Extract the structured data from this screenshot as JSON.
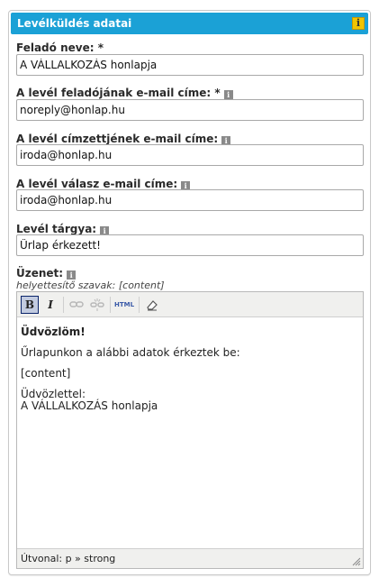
{
  "panel": {
    "title": "Levélküldés adatai",
    "info_glyph": "i"
  },
  "fields": [
    {
      "label": "Feladó neve: *",
      "value": "A VÁLLALKOZÁS honlapja",
      "has_info": false
    },
    {
      "label": "A levél feladójának e-mail címe: *",
      "value": "noreply@honlap.hu",
      "has_info": true
    },
    {
      "label": "A levél címzettjének e-mail címe:",
      "value": "iroda@honlap.hu",
      "has_info": true
    },
    {
      "label": "A levél válasz e-mail címe:",
      "value": "iroda@honlap.hu",
      "has_info": true
    },
    {
      "label": "Levél tárgya:",
      "value": "Űrlap érkezett!",
      "has_info": true
    }
  ],
  "message": {
    "label": "Üzenet:",
    "hint": "helyettesítő szavak: [content]",
    "toolbar": {
      "bold": "B",
      "italic": "I",
      "link": "link-icon",
      "unlink": "unlink-icon",
      "html": "HTML",
      "cleanup": "eraser-icon"
    },
    "content": {
      "greeting": "Üdvözlöm!",
      "line1": "Űrlapunkon a alábbi adatok érkeztek be:",
      "placeholder": "[content]",
      "closing1": "Üdvözlettel:",
      "closing2": "A VÁLLALKOZÁS honlapja"
    },
    "status_path": "Útvonal: p » strong"
  },
  "colors": {
    "header": "#1ba1d6",
    "info_badge": "#f2c400"
  }
}
